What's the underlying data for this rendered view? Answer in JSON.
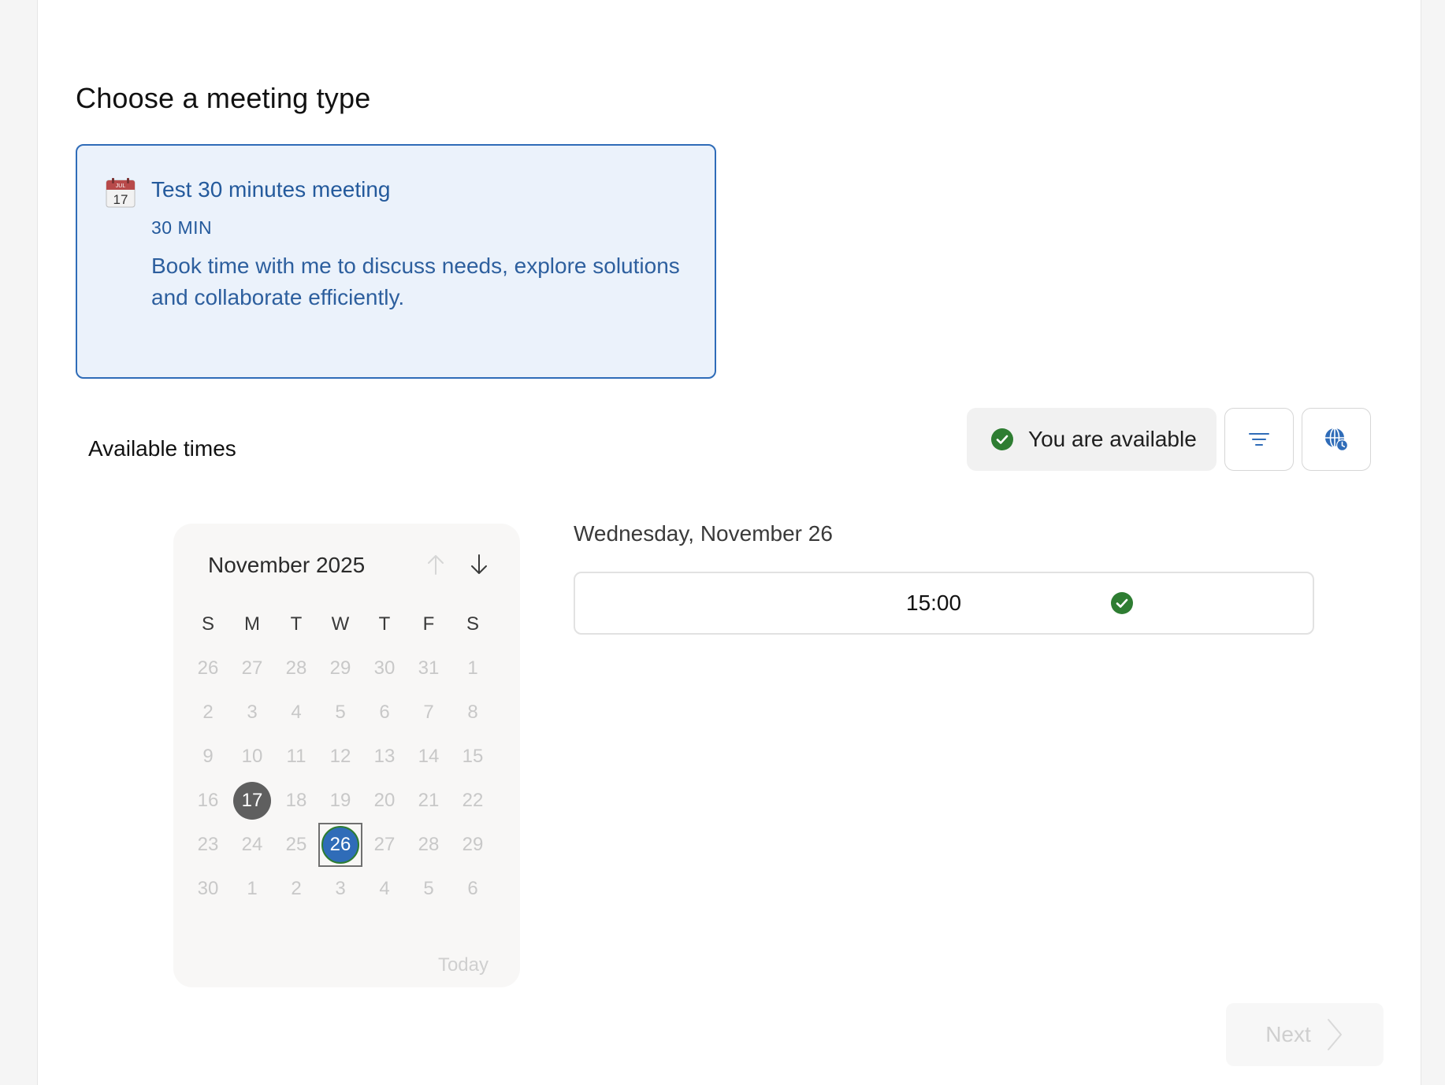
{
  "meeting_section": {
    "title": "Choose a meeting type",
    "card": {
      "icon": "calendar-icon",
      "icon_month": "JUL",
      "icon_day": "17",
      "title": "Test 30 minutes meeting",
      "duration": "30 MIN",
      "description": "Book time with me to discuss needs, explore solutions and collaborate efficiently."
    }
  },
  "availability": {
    "label": "Available times",
    "status_text": "You are available",
    "status_icon": "check-circle-icon",
    "filter_icon": "filter-icon",
    "timezone_icon": "globe-clock-icon"
  },
  "calendar": {
    "month_label": "November 2025",
    "weekdays": [
      "S",
      "M",
      "T",
      "W",
      "T",
      "F",
      "S"
    ],
    "weeks": [
      [
        "26",
        "27",
        "28",
        "29",
        "30",
        "31",
        "1"
      ],
      [
        "2",
        "3",
        "4",
        "5",
        "6",
        "7",
        "8"
      ],
      [
        "9",
        "10",
        "11",
        "12",
        "13",
        "14",
        "15"
      ],
      [
        "16",
        "17",
        "18",
        "19",
        "20",
        "21",
        "22"
      ],
      [
        "23",
        "24",
        "25",
        "26",
        "27",
        "28",
        "29"
      ],
      [
        "30",
        "1",
        "2",
        "3",
        "4",
        "5",
        "6"
      ]
    ],
    "today": "17",
    "selected": "26",
    "today_link": "Today"
  },
  "slots": {
    "date_heading": "Wednesday, November 26",
    "items": [
      {
        "time": "15:00"
      }
    ]
  },
  "footer": {
    "next_label": "Next"
  },
  "colors": {
    "accent": "#2f6cb8",
    "available": "#2e7d32",
    "today_fill": "#5f5f5f"
  }
}
